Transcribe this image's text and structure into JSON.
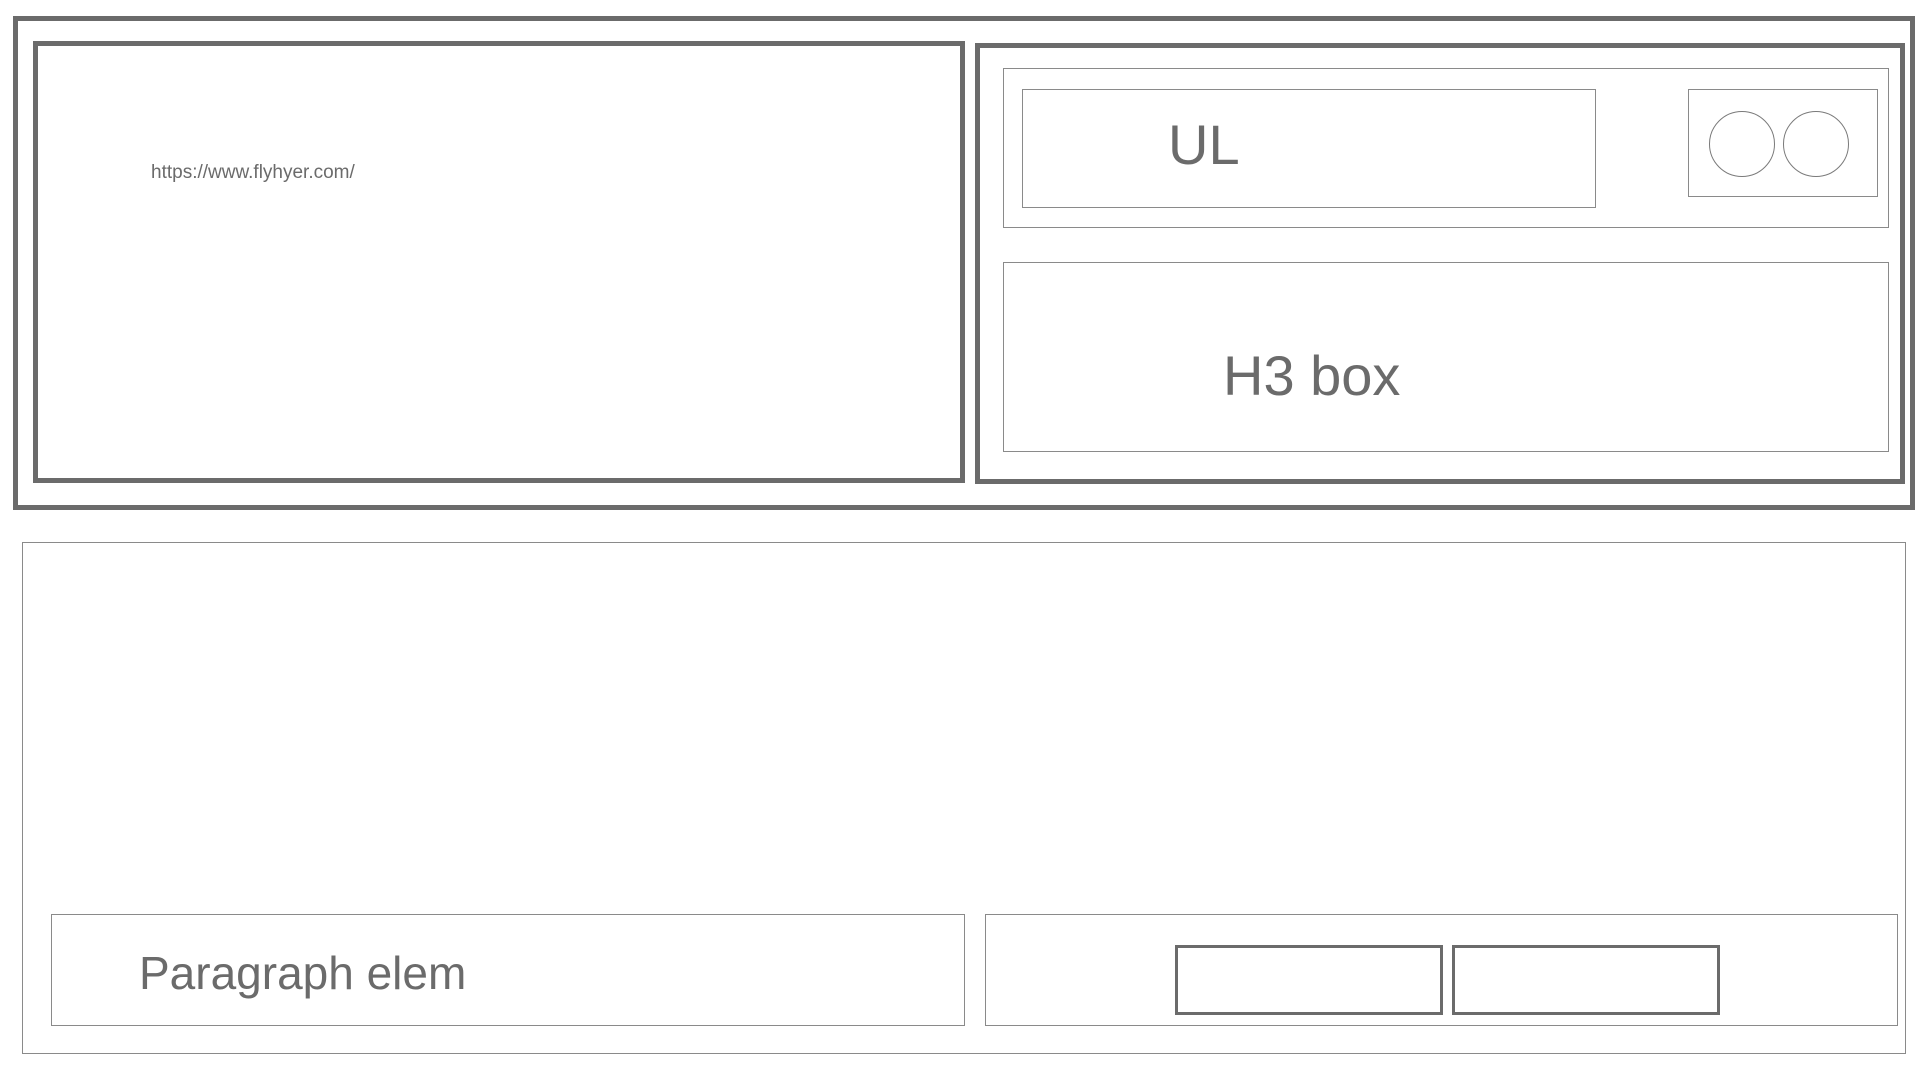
{
  "header": {
    "url_text": "https://www.flyhyer.com/"
  },
  "nav": {
    "list_label": "UL",
    "avatars": [
      "avatar-circle",
      "avatar-circle"
    ]
  },
  "hero": {
    "heading_label": "H3 box"
  },
  "footer": {
    "paragraph_label": "Paragraph elem",
    "buttons": [
      "",
      ""
    ]
  },
  "colors": {
    "stroke": "#6b6b6b",
    "thin_stroke": "#8a8a8a",
    "background": "#ffffff"
  }
}
